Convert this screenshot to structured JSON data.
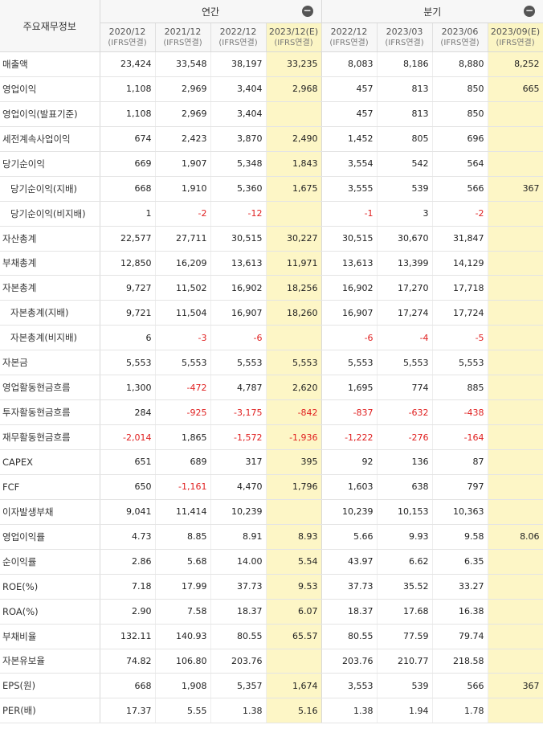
{
  "header": {
    "title": "주요재무정보",
    "annual_label": "연간",
    "quarter_label": "분기",
    "collapse_icon": "−"
  },
  "columns": [
    {
      "period": "2020/12",
      "basis": "(IFRS연결)",
      "estimate": false
    },
    {
      "period": "2021/12",
      "basis": "(IFRS연결)",
      "estimate": false
    },
    {
      "period": "2022/12",
      "basis": "(IFRS연결)",
      "estimate": false
    },
    {
      "period": "2023/12(E)",
      "basis": "(IFRS연결)",
      "estimate": true
    },
    {
      "period": "2022/12",
      "basis": "(IFRS연결)",
      "estimate": false
    },
    {
      "period": "2023/03",
      "basis": "(IFRS연결)",
      "estimate": false
    },
    {
      "period": "2023/06",
      "basis": "(IFRS연결)",
      "estimate": false
    },
    {
      "period": "2023/09(E)",
      "basis": "(IFRS연결)",
      "estimate": true
    }
  ],
  "rows": [
    {
      "label": "매출액",
      "indent": false,
      "values": [
        "23,424",
        "33,548",
        "38,197",
        "33,235",
        "8,083",
        "8,186",
        "8,880",
        "8,252"
      ]
    },
    {
      "label": "영업이익",
      "indent": false,
      "values": [
        "1,108",
        "2,969",
        "3,404",
        "2,968",
        "457",
        "813",
        "850",
        "665"
      ]
    },
    {
      "label": "영업이익(발표기준)",
      "indent": false,
      "values": [
        "1,108",
        "2,969",
        "3,404",
        "",
        "457",
        "813",
        "850",
        ""
      ]
    },
    {
      "label": "세전계속사업이익",
      "indent": false,
      "values": [
        "674",
        "2,423",
        "3,870",
        "2,490",
        "1,452",
        "805",
        "696",
        ""
      ]
    },
    {
      "label": "당기순이익",
      "indent": false,
      "values": [
        "669",
        "1,907",
        "5,348",
        "1,843",
        "3,554",
        "542",
        "564",
        ""
      ]
    },
    {
      "label": "당기순이익(지배)",
      "indent": true,
      "values": [
        "668",
        "1,910",
        "5,360",
        "1,675",
        "3,555",
        "539",
        "566",
        "367"
      ]
    },
    {
      "label": "당기순이익(비지배)",
      "indent": true,
      "values": [
        "1",
        "-2",
        "-12",
        "",
        "-1",
        "3",
        "-2",
        ""
      ]
    },
    {
      "label": "자산총계",
      "indent": false,
      "values": [
        "22,577",
        "27,711",
        "30,515",
        "30,227",
        "30,515",
        "30,670",
        "31,847",
        ""
      ]
    },
    {
      "label": "부채총계",
      "indent": false,
      "values": [
        "12,850",
        "16,209",
        "13,613",
        "11,971",
        "13,613",
        "13,399",
        "14,129",
        ""
      ]
    },
    {
      "label": "자본총계",
      "indent": false,
      "values": [
        "9,727",
        "11,502",
        "16,902",
        "18,256",
        "16,902",
        "17,270",
        "17,718",
        ""
      ]
    },
    {
      "label": "자본총계(지배)",
      "indent": true,
      "values": [
        "9,721",
        "11,504",
        "16,907",
        "18,260",
        "16,907",
        "17,274",
        "17,724",
        ""
      ]
    },
    {
      "label": "자본총계(비지배)",
      "indent": true,
      "values": [
        "6",
        "-3",
        "-6",
        "",
        "-6",
        "-4",
        "-5",
        ""
      ]
    },
    {
      "label": "자본금",
      "indent": false,
      "values": [
        "5,553",
        "5,553",
        "5,553",
        "5,553",
        "5,553",
        "5,553",
        "5,553",
        ""
      ]
    },
    {
      "label": "영업활동현금흐름",
      "indent": false,
      "values": [
        "1,300",
        "-472",
        "4,787",
        "2,620",
        "1,695",
        "774",
        "885",
        ""
      ]
    },
    {
      "label": "투자활동현금흐름",
      "indent": false,
      "values": [
        "284",
        "-925",
        "-3,175",
        "-842",
        "-837",
        "-632",
        "-438",
        ""
      ]
    },
    {
      "label": "재무활동현금흐름",
      "indent": false,
      "values": [
        "-2,014",
        "1,865",
        "-1,572",
        "-1,936",
        "-1,222",
        "-276",
        "-164",
        ""
      ]
    },
    {
      "label": "CAPEX",
      "indent": false,
      "values": [
        "651",
        "689",
        "317",
        "395",
        "92",
        "136",
        "87",
        ""
      ]
    },
    {
      "label": "FCF",
      "indent": false,
      "values": [
        "650",
        "-1,161",
        "4,470",
        "1,796",
        "1,603",
        "638",
        "797",
        ""
      ]
    },
    {
      "label": "이자발생부채",
      "indent": false,
      "values": [
        "9,041",
        "11,414",
        "10,239",
        "",
        "10,239",
        "10,153",
        "10,363",
        ""
      ]
    },
    {
      "label": "영업이익률",
      "indent": false,
      "values": [
        "4.73",
        "8.85",
        "8.91",
        "8.93",
        "5.66",
        "9.93",
        "9.58",
        "8.06"
      ]
    },
    {
      "label": "순이익률",
      "indent": false,
      "values": [
        "2.86",
        "5.68",
        "14.00",
        "5.54",
        "43.97",
        "6.62",
        "6.35",
        ""
      ]
    },
    {
      "label": "ROE(%)",
      "indent": false,
      "values": [
        "7.18",
        "17.99",
        "37.73",
        "9.53",
        "37.73",
        "35.52",
        "33.27",
        ""
      ]
    },
    {
      "label": "ROA(%)",
      "indent": false,
      "values": [
        "2.90",
        "7.58",
        "18.37",
        "6.07",
        "18.37",
        "17.68",
        "16.38",
        ""
      ]
    },
    {
      "label": "부채비율",
      "indent": false,
      "values": [
        "132.11",
        "140.93",
        "80.55",
        "65.57",
        "80.55",
        "77.59",
        "79.74",
        ""
      ]
    },
    {
      "label": "자본유보율",
      "indent": false,
      "values": [
        "74.82",
        "106.80",
        "203.76",
        "",
        "203.76",
        "210.77",
        "218.58",
        ""
      ]
    },
    {
      "label": "EPS(원)",
      "indent": false,
      "values": [
        "668",
        "1,908",
        "5,357",
        "1,674",
        "3,553",
        "539",
        "566",
        "367"
      ]
    },
    {
      "label": "PER(배)",
      "indent": false,
      "values": [
        "17.37",
        "5.55",
        "1.38",
        "5.16",
        "1.38",
        "1.94",
        "1.78",
        ""
      ]
    }
  ],
  "colors": {
    "estimate_bg": "#fdf6c6",
    "negative": "#e02020",
    "header_bg": "#f7f7f7"
  }
}
